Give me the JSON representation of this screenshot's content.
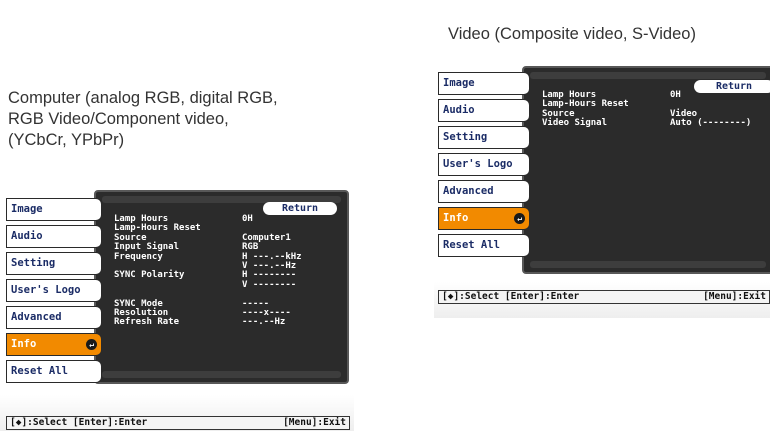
{
  "left_caption": {
    "line1": "Computer (analog RGB, digital RGB,",
    "line2": "RGB Video/Component video,",
    "line3": "(YCbCr, YPbPr)"
  },
  "right_caption": "Video (Composite video, S-Video)",
  "menu_items": [
    "Image",
    "Audio",
    "Setting",
    "User's Logo",
    "Advanced",
    "Info",
    "Reset All"
  ],
  "selected_menu_item": "Info",
  "enter_icon_glyph": "↵",
  "return_label": "Return",
  "computer_info": {
    "rows": [
      {
        "label": "Lamp Hours",
        "value": "0H"
      },
      {
        "label": "Lamp-Hours Reset",
        "value": ""
      },
      {
        "label": "Source",
        "value": "Computer1"
      },
      {
        "label": "Input Signal",
        "value": "RGB"
      },
      {
        "label": "Frequency",
        "value": "H ---.--kHz"
      },
      {
        "label": "",
        "value": "V ---.--Hz"
      },
      {
        "label": "SYNC Polarity",
        "value": "H --------"
      },
      {
        "label": "",
        "value": "V --------"
      },
      {
        "label": "",
        "value": ""
      },
      {
        "label": "SYNC Mode",
        "value": "-----"
      },
      {
        "label": "Resolution",
        "value": "----x----"
      },
      {
        "label": "Refresh Rate",
        "value": "---.--Hz"
      }
    ]
  },
  "video_info": {
    "rows": [
      {
        "label": "Lamp Hours",
        "value": "0H"
      },
      {
        "label": "Lamp-Hours Reset",
        "value": ""
      },
      {
        "label": "Source",
        "value": "Video"
      },
      {
        "label": "Video Signal",
        "value": "Auto (--------)"
      }
    ]
  },
  "footer": {
    "select": "[◆]:Select [Enter]:Enter",
    "exit": "[Menu]:Exit"
  },
  "colors": {
    "selected_item": "#f28a00",
    "panel": "#2b2b2b",
    "menu_text": "#1b2c66"
  }
}
